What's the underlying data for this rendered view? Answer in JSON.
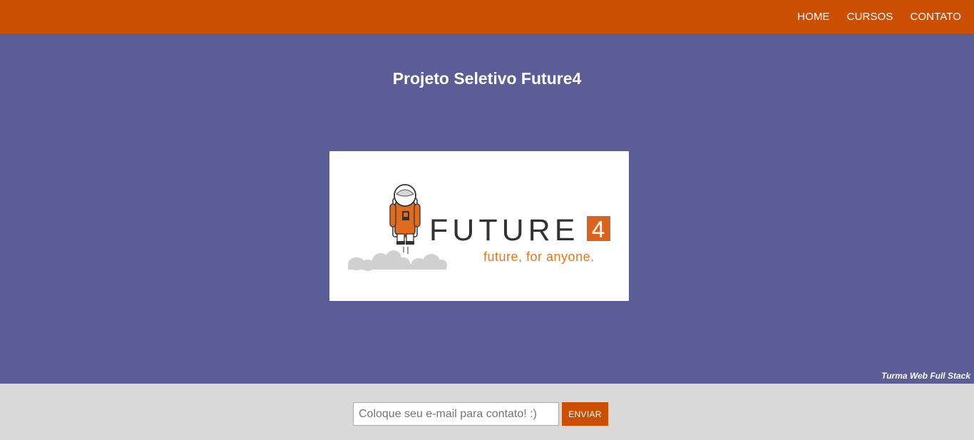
{
  "nav": {
    "items": [
      {
        "label": "HOME"
      },
      {
        "label": "CURSOS"
      },
      {
        "label": "CONTATO"
      }
    ]
  },
  "hero": {
    "title": "Projeto Seletivo Future4",
    "logo": {
      "wordmark": "FUTURE",
      "digit": "4",
      "tagline": "future, for anyone."
    },
    "credit": "Turma Web Full Stack"
  },
  "footer": {
    "email_placeholder": "Coloque seu e-mail para contato! :)",
    "email_value": "",
    "send_label": "ENVIAR"
  },
  "colors": {
    "header": "#cc4e00",
    "main_bg": "#5b5e96",
    "footer_bg": "#d9d9d9",
    "accent": "#cc4e00",
    "tagline": "#e07a1f"
  }
}
